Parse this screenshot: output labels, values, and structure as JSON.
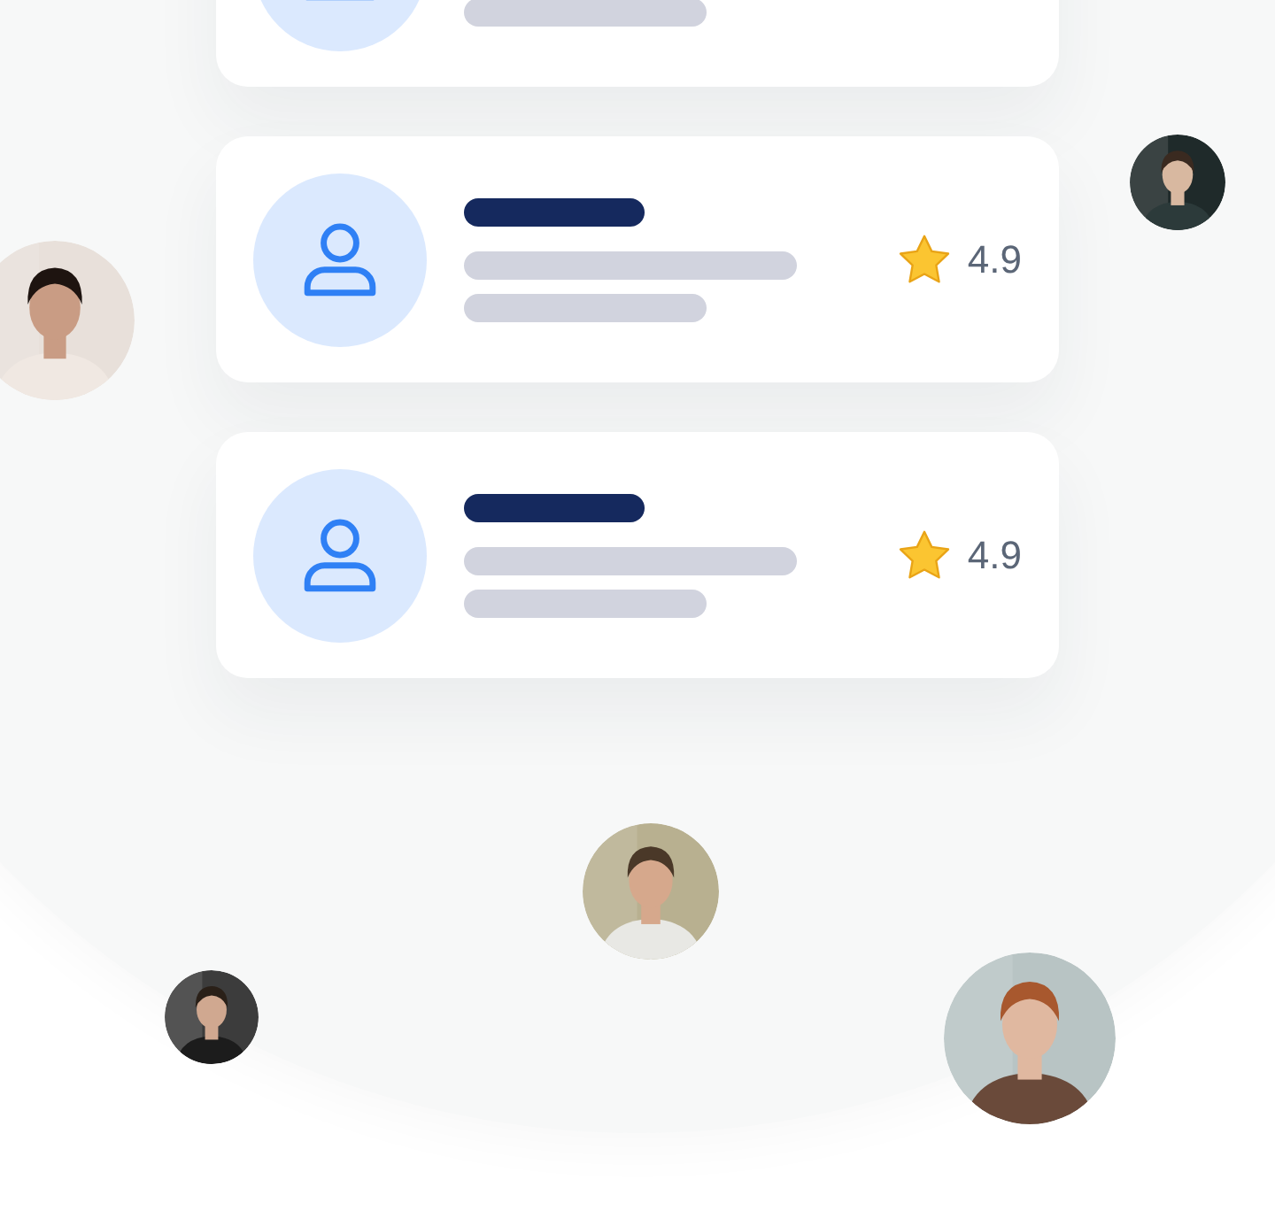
{
  "cards": [
    {
      "kind": "profile"
    },
    {
      "kind": "profile",
      "rating": "4.9"
    },
    {
      "kind": "profile",
      "rating": "4.9"
    }
  ]
}
